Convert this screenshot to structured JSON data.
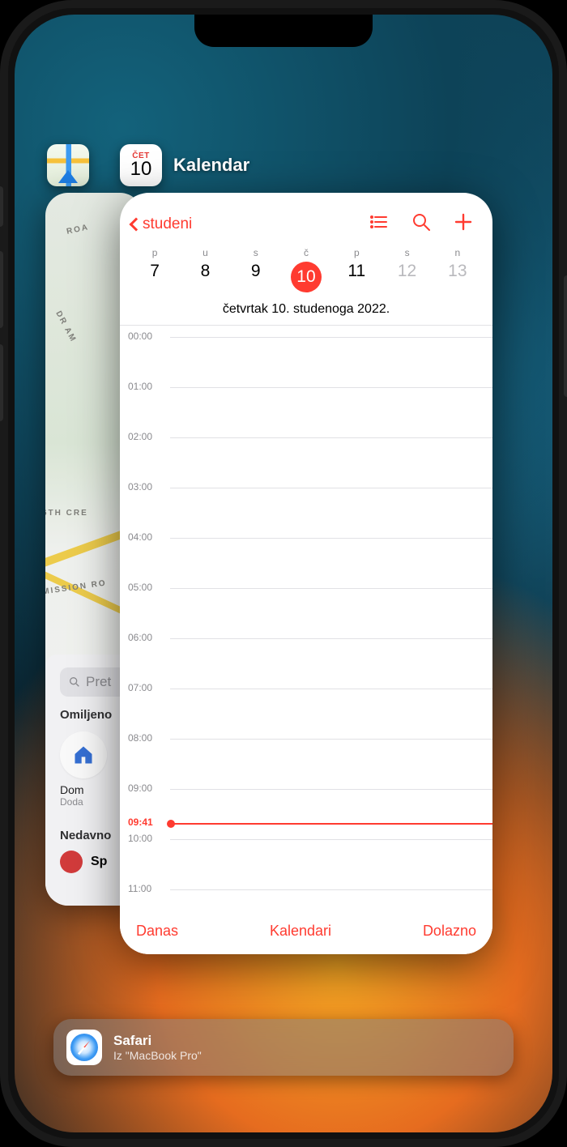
{
  "switcher": {
    "maps": {
      "search_placeholder": "Pret",
      "favorites_heading": "Omiljeno",
      "home_label": "Dom",
      "home_sub": "Doda",
      "recent_heading": "Nedavno",
      "recent_item": "Sp",
      "road_labels": [
        "ROA",
        "DR AM",
        "6TH CRE",
        "MISSION RO"
      ]
    },
    "calendar": {
      "app_title": "Kalendar",
      "icon_dow": "ČET",
      "icon_day": "10",
      "back_label": "studeni",
      "dows": [
        "p",
        "u",
        "s",
        "č",
        "p",
        "s",
        "n"
      ],
      "dates": [
        "7",
        "8",
        "9",
        "10",
        "11",
        "12",
        "13"
      ],
      "today_index": 3,
      "weekend_indices": [
        5,
        6
      ],
      "long_date": "četvrtak 10. studenoga 2022.",
      "hours": [
        "00:00",
        "01:00",
        "02:00",
        "03:00",
        "04:00",
        "05:00",
        "06:00",
        "07:00",
        "08:00",
        "09:00",
        "10:00",
        "11:00"
      ],
      "now_time": "09:41",
      "footer": {
        "today": "Danas",
        "calendars": "Kalendari",
        "inbox": "Dolazno"
      }
    }
  },
  "handoff": {
    "app": "Safari",
    "source": "Iz \"MacBook Pro\""
  }
}
